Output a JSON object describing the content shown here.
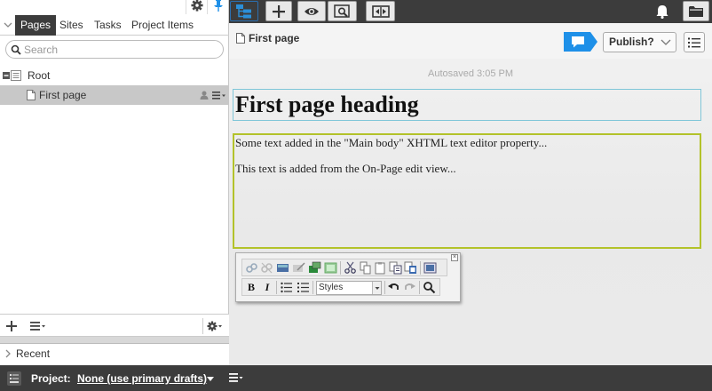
{
  "left_panel": {
    "tabs": [
      {
        "label": "Pages",
        "active": true
      },
      {
        "label": "Sites",
        "active": false
      },
      {
        "label": "Tasks",
        "active": false
      },
      {
        "label": "Project Items",
        "active": false
      }
    ],
    "search": {
      "placeholder": "Search"
    },
    "tree": {
      "root_label": "Root",
      "items": [
        {
          "label": "First page",
          "selected": true
        }
      ]
    },
    "recent_label": "Recent",
    "icons": {
      "gear": "gear-icon",
      "pin": "pin-icon",
      "add": "plus-icon",
      "menu": "menu-icon"
    }
  },
  "toolbar": {
    "buttons": [
      "page-tree-toggle-icon",
      "plus-icon",
      "eye-icon",
      "preview-icon",
      "compare-icon"
    ],
    "right_icons": [
      "bell-icon",
      "folder-icon"
    ],
    "accent_color": "#2b6fb0"
  },
  "content": {
    "page_title": "First page",
    "publish_label": "Publish?",
    "autosaved": "Autosaved 3:05 PM",
    "heading": "First page heading",
    "body_paragraphs": [
      "Some text added in the \"Main body\" XHTML text editor property...",
      "This text is added from the On-Page edit view..."
    ],
    "comment_color": "#1e90e8",
    "heading_border_color": "#7fc6d8",
    "body_border_color": "#b3c22a"
  },
  "editor_toolbar": {
    "bold_label": "B",
    "italic_label": "I",
    "styles_value": "Styles",
    "close_label": "×"
  },
  "bottom_bar": {
    "project_label": "Project:",
    "project_value": "None (use primary drafts)"
  }
}
